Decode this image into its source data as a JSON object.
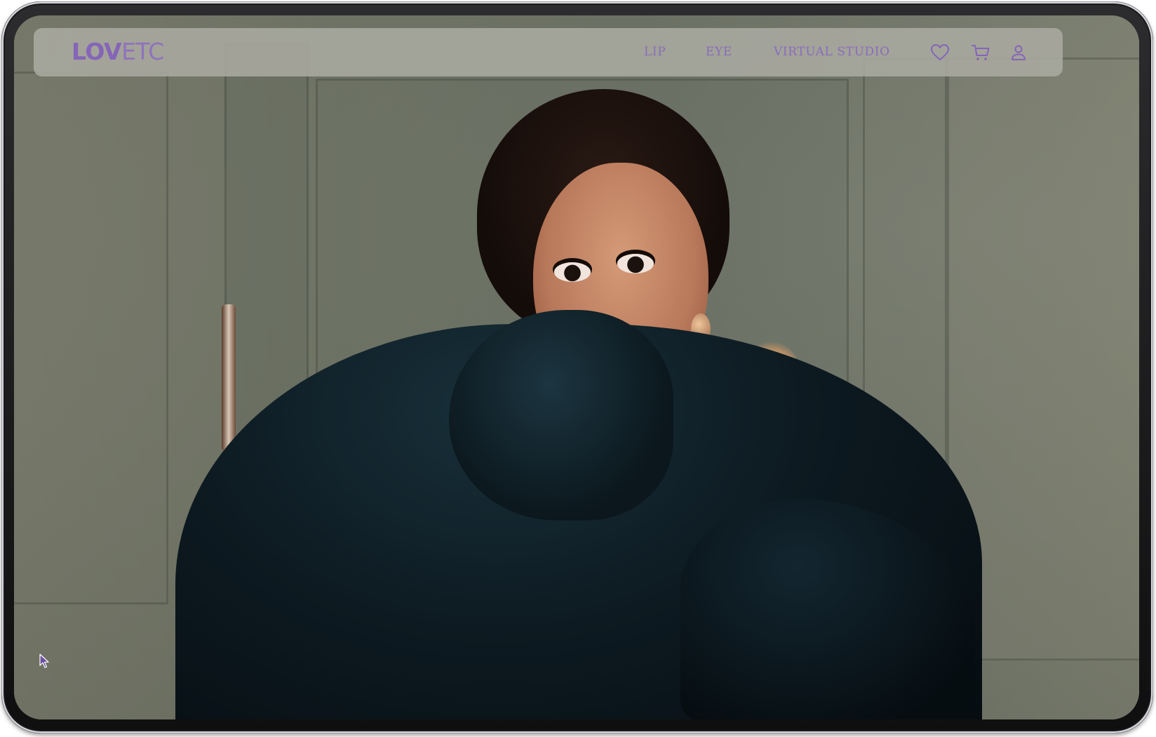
{
  "brand": {
    "logo_bold": "LOV",
    "logo_light": "ETC",
    "accent_color": "#8565b7"
  },
  "nav": {
    "links": [
      {
        "label": "LIP"
      },
      {
        "label": "EYE"
      },
      {
        "label": "VIRTUAL STUDIO"
      }
    ],
    "icons": [
      "heart-icon",
      "cart-icon",
      "user-icon"
    ]
  },
  "hero": {
    "image": "editorial photo of a woman with dark updo and red lips wrapped in dark teal fabric"
  }
}
